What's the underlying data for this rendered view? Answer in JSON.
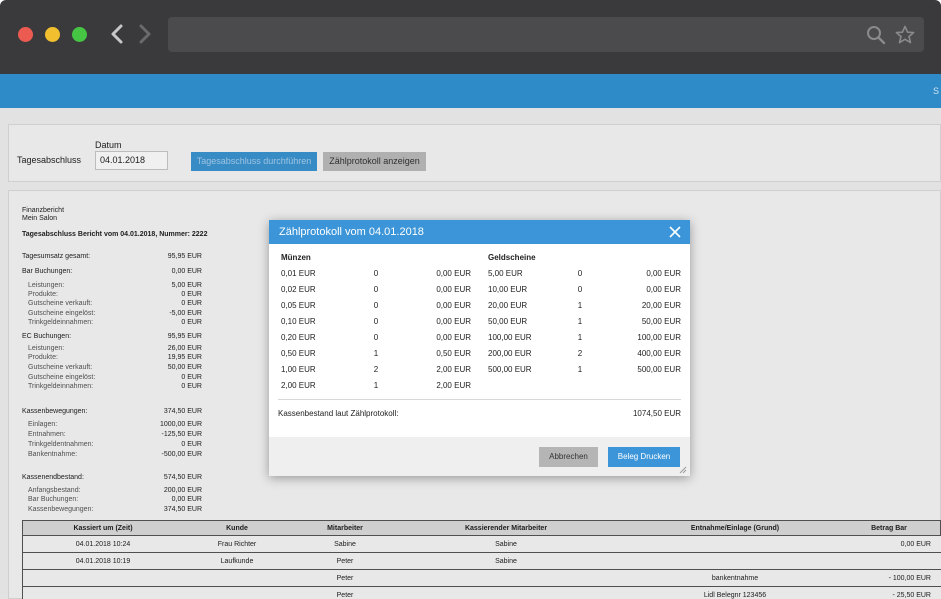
{
  "app_header": {
    "text": "S"
  },
  "top_panel": {
    "tagesabschluss_label": "Tagesabschluss",
    "datum_label": "Datum",
    "datum_value": "04.01.2018",
    "btn_durchfuehren": "Tagesabschluss durchführen",
    "btn_zaehlprotokoll": "Zählprotokoll anzeigen"
  },
  "report": {
    "line1": "Finanzbericht",
    "line2": "Mein Salon",
    "heading": "Tagesabschluss Bericht vom 04.01.2018, Nummer: 2222",
    "rows": [
      {
        "label": "Tagesumsatz gesamt:",
        "value": "95,95 EUR",
        "indent": false
      },
      {
        "label": "Bar Buchungen:",
        "value": "0,00 EUR",
        "indent": false
      },
      {
        "label": "Leistungen:",
        "value": "5,00 EUR",
        "indent": true
      },
      {
        "label": "Produkte:",
        "value": "0 EUR",
        "indent": true
      },
      {
        "label": "Gutscheine verkauft:",
        "value": "0 EUR",
        "indent": true
      },
      {
        "label": "Gutscheine eingelöst:",
        "value": "-5,00 EUR",
        "indent": true
      },
      {
        "label": "Trinkgeldeinnahmen:",
        "value": "0 EUR",
        "indent": true
      },
      {
        "label": "EC Buchungen:",
        "value": "95,95 EUR",
        "indent": false
      },
      {
        "label": "Leistungen:",
        "value": "26,00 EUR",
        "indent": true
      },
      {
        "label": "Produkte:",
        "value": "19,95 EUR",
        "indent": true
      },
      {
        "label": "Gutscheine verkauft:",
        "value": "50,00 EUR",
        "indent": true
      },
      {
        "label": "Gutscheine eingelöst:",
        "value": "0 EUR",
        "indent": true
      },
      {
        "label": "Trinkgeldeinnahmen:",
        "value": "0 EUR",
        "indent": true
      },
      {
        "label": "Kassenbewegungen:",
        "value": "374,50 EUR",
        "indent": false
      },
      {
        "label": "Einlagen:",
        "value": "1000,00 EUR",
        "indent": true
      },
      {
        "label": "Entnahmen:",
        "value": "-125,50 EUR",
        "indent": true
      },
      {
        "label": "Trinkgeldentnahmen:",
        "value": "0 EUR",
        "indent": true
      },
      {
        "label": "Bankentnahme:",
        "value": "-500,00 EUR",
        "indent": true
      },
      {
        "label": "Kassenendbestand:",
        "value": "574,50 EUR",
        "indent": false
      },
      {
        "label": "Anfangsbestand:",
        "value": "200,00 EUR",
        "indent": true
      },
      {
        "label": "Bar Buchungen:",
        "value": "0,00 EUR",
        "indent": true
      },
      {
        "label": "Kassenbewegungen:",
        "value": "374,50 EUR",
        "indent": true
      }
    ]
  },
  "table": {
    "headers": [
      "Kassiert um (Zeit)",
      "Kunde",
      "Mitarbeiter",
      "Kassierender Mitarbeiter",
      "Entnahme/Einlage (Grund)",
      "Betrag Bar"
    ],
    "rows": [
      [
        "04.01.2018 10:24",
        "Frau Richter",
        "Sabine",
        "Sabine",
        "",
        "0,00 EUR"
      ],
      [
        "04.01.2018 10:19",
        "Laufkunde",
        "Peter",
        "Sabine",
        "",
        ""
      ],
      [
        "",
        "",
        "Peter",
        "",
        "bankentnahme",
        "- 100,00 EUR"
      ],
      [
        "",
        "",
        "Peter",
        "",
        "Lidl Belegnr 123456",
        "- 25,50 EUR"
      ]
    ]
  },
  "modal": {
    "title": "Zählprotokoll vom 04.01.2018",
    "muenzen_label": "Münzen",
    "geldscheine_label": "Geldscheine",
    "muenzen": [
      {
        "denom": "0,01 EUR",
        "count": "0",
        "total": "0,00 EUR"
      },
      {
        "denom": "0,02 EUR",
        "count": "0",
        "total": "0,00 EUR"
      },
      {
        "denom": "0,05 EUR",
        "count": "0",
        "total": "0,00 EUR"
      },
      {
        "denom": "0,10 EUR",
        "count": "0",
        "total": "0,00 EUR"
      },
      {
        "denom": "0,20 EUR",
        "count": "0",
        "total": "0,00 EUR"
      },
      {
        "denom": "0,50 EUR",
        "count": "1",
        "total": "0,50 EUR"
      },
      {
        "denom": "1,00 EUR",
        "count": "2",
        "total": "2,00 EUR"
      },
      {
        "denom": "2,00 EUR",
        "count": "1",
        "total": "2,00 EUR"
      }
    ],
    "geldscheine": [
      {
        "denom": "5,00 EUR",
        "count": "0",
        "total": "0,00 EUR"
      },
      {
        "denom": "10,00 EUR",
        "count": "0",
        "total": "0,00 EUR"
      },
      {
        "denom": "20,00 EUR",
        "count": "1",
        "total": "20,00 EUR"
      },
      {
        "denom": "50,00 EUR",
        "count": "1",
        "total": "50,00 EUR"
      },
      {
        "denom": "100,00 EUR",
        "count": "1",
        "total": "100,00 EUR"
      },
      {
        "denom": "200,00 EUR",
        "count": "2",
        "total": "400,00 EUR"
      },
      {
        "denom": "500,00 EUR",
        "count": "1",
        "total": "500,00 EUR"
      }
    ],
    "kassenbestand_label": "Kassenbestand laut Zählprotokoll:",
    "kassenbestand_value": "1074,50 EUR",
    "btn_abbrechen": "Abbrechen",
    "btn_beleg": "Beleg Drucken"
  },
  "icons": {
    "back": "chevron-left-icon",
    "forward": "chevron-right-icon",
    "search": "search-icon",
    "star": "star-icon",
    "close": "close-icon"
  },
  "colors": {
    "accent": "#3b95d8",
    "header": "#2f8bc8",
    "chrome": "#3a3a3c"
  }
}
